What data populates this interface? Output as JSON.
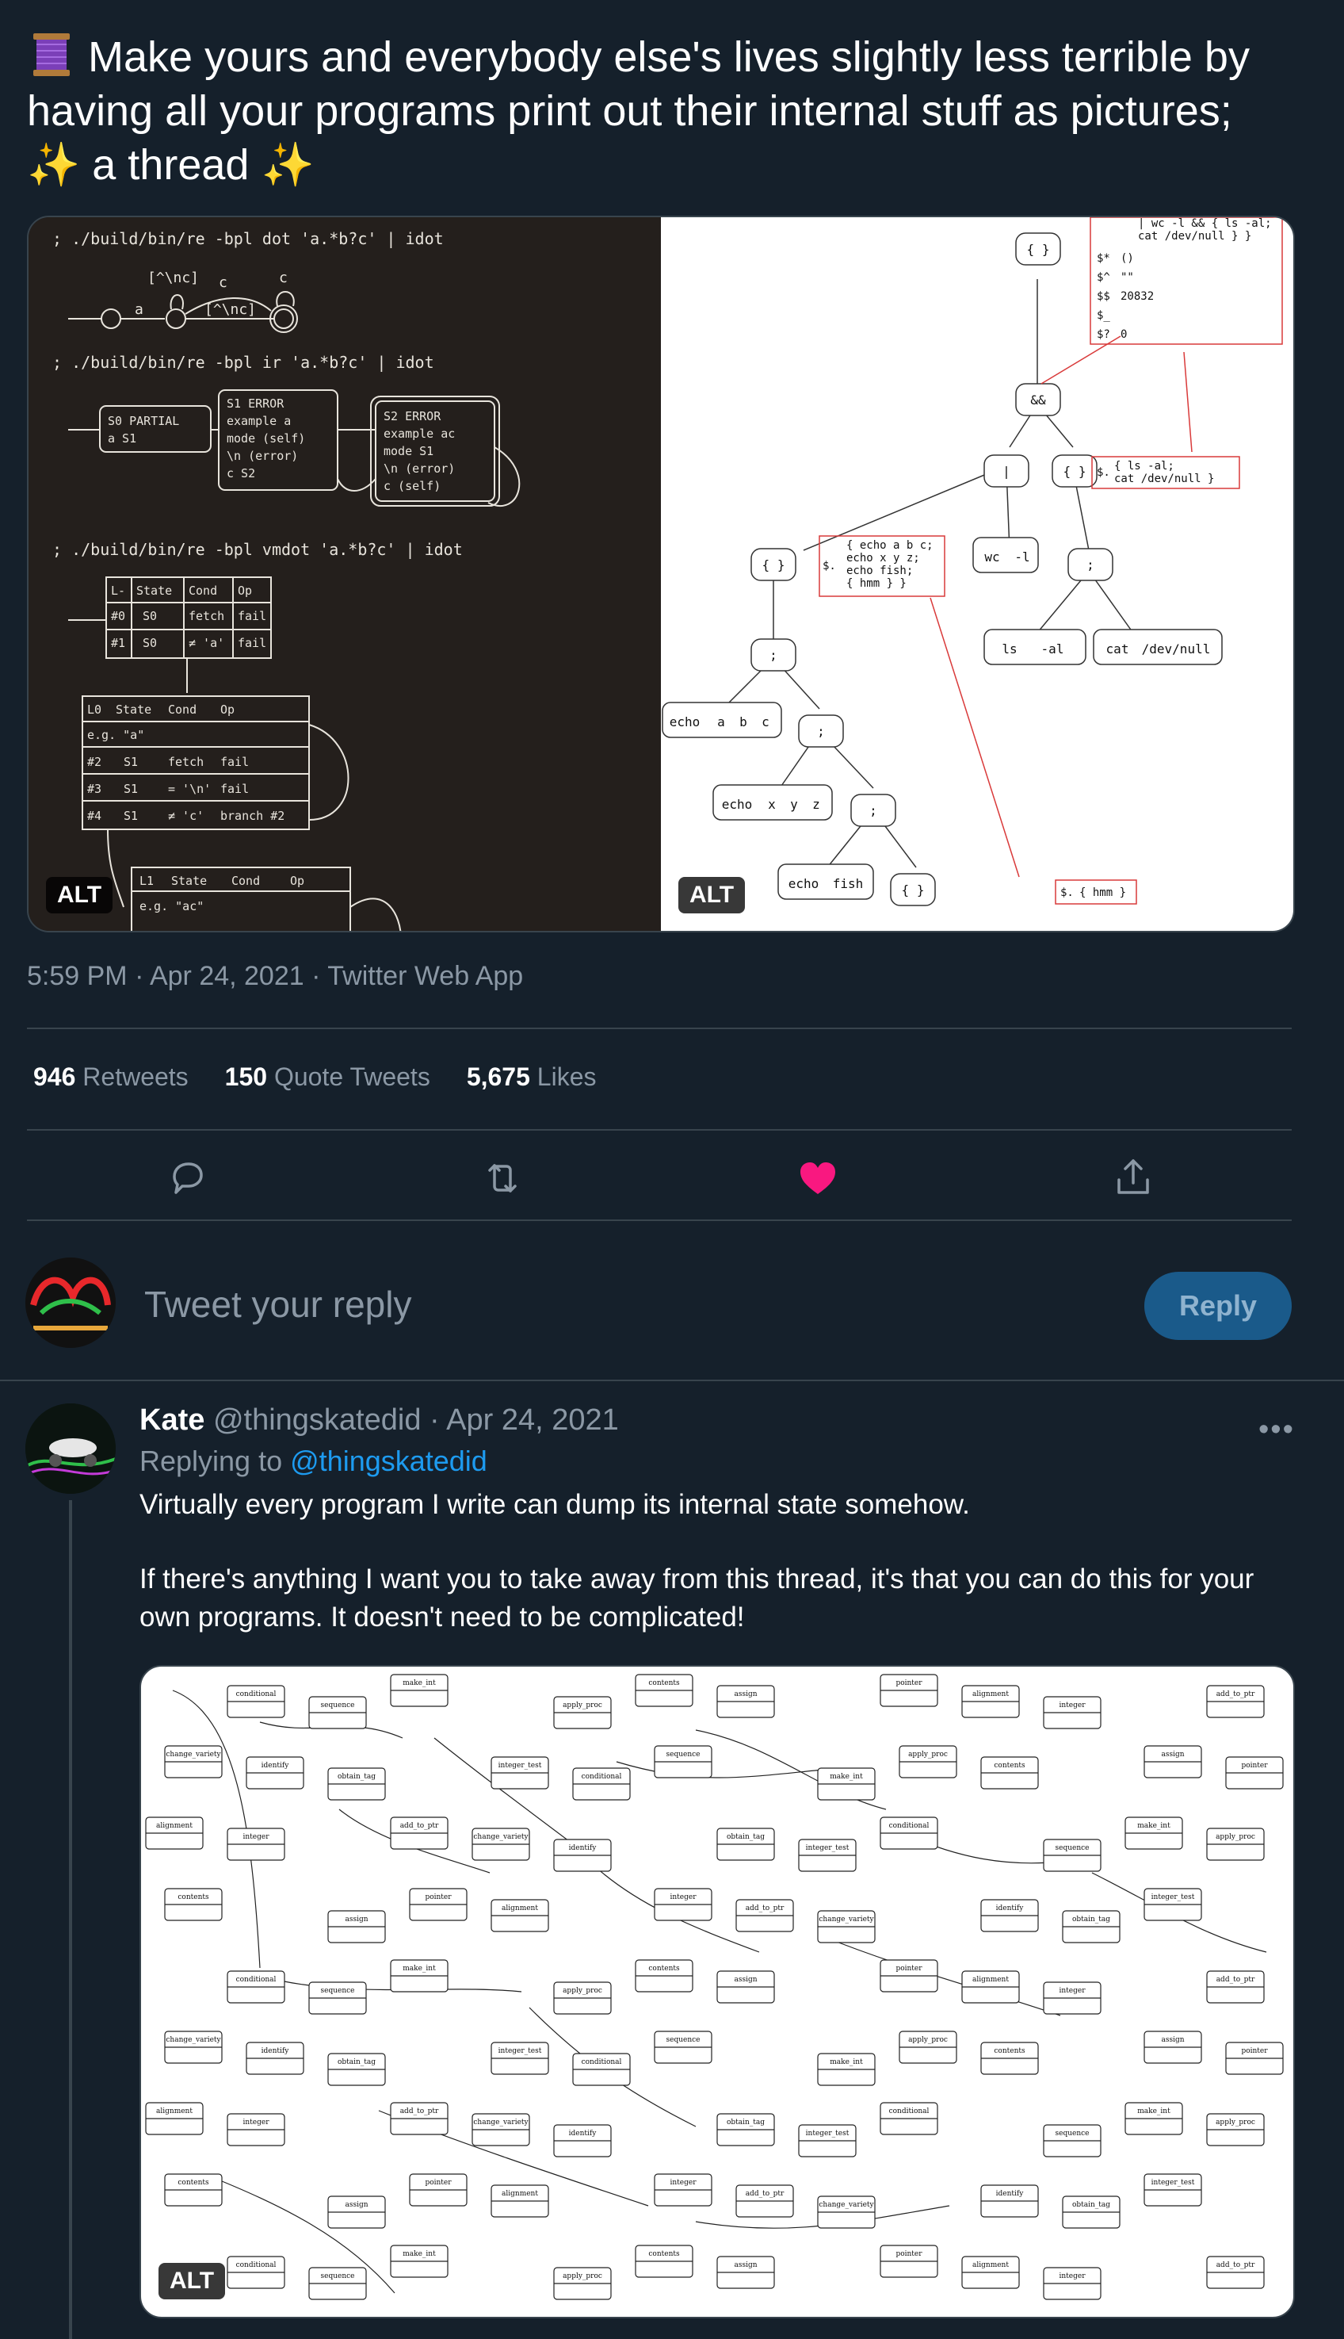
{
  "tweet": {
    "line1": "Make yours and everybody else's lives slightly less terrible by",
    "line2": "having all your programs print out their internal stuff as pictures;",
    "line3": "a thread",
    "timestamp": "5:59 PM · Apr 24, 2021 · Twitter Web App",
    "alt_label": "ALT"
  },
  "left_image": {
    "cmd1": "; ./build/bin/re -bpl dot 'a.*b?c' | idot",
    "cmd2": "; ./build/bin/re -bpl ir 'a.*b?c' | idot",
    "cmd3": "; ./build/bin/re -bpl vmdot 'a.*b?c' | idot",
    "dfa_labels": [
      "[^\\nc]",
      "c",
      "c",
      "a",
      "[^\\nc]"
    ],
    "ir_s0": [
      "S0 PARTIAL",
      "a    S1"
    ],
    "ir_s1": [
      "S1        ERROR",
      "example a",
      "mode    (self)",
      "\\n          (error)",
      "c          S2"
    ],
    "ir_s2": [
      "S2        ERROR",
      "example ac",
      "mode    S1",
      "\\n          (error)",
      "c          (self)"
    ],
    "vm_table1": {
      "headers": [
        "L-",
        "State",
        "Cond",
        "Op"
      ],
      "rows": [
        [
          "#0",
          "S0",
          "fetch",
          "fail"
        ],
        [
          "#1",
          "S0",
          "≠ 'a'",
          "fail"
        ]
      ]
    },
    "vm_table2": {
      "headers": [
        "L0",
        "State",
        "Cond",
        "Op"
      ],
      "example": "e.g. \"a\"",
      "rows": [
        [
          "#2",
          "S1",
          "fetch",
          "fail"
        ],
        [
          "#3",
          "S1",
          "= '\\n'",
          "fail"
        ],
        [
          "#4",
          "S1",
          "≠ 'c'",
          "branch #2"
        ]
      ]
    },
    "vm_table3": {
      "headers": [
        "L1",
        "State",
        "Cond",
        "Op"
      ],
      "example": "e.g. \"ac\""
    }
  },
  "right_image": {
    "nodes": [
      "{ }",
      "&&",
      "|",
      "{ }",
      "{ }",
      "!",
      ";",
      ";",
      "!",
      "!",
      ";",
      "!",
      ";",
      "!",
      "{ }"
    ],
    "leaf_labels": [
      "wc",
      "-l",
      "ls",
      "-al",
      "cat",
      "/dev/null",
      "echo",
      "a",
      "b",
      "c",
      "echo",
      "x",
      "y",
      "z",
      "echo",
      "fish"
    ],
    "vars": [
      "$*",
      "$^",
      "$$",
      "$_",
      "$?"
    ],
    "var_values": [
      "()",
      "\"\"",
      "20832",
      "",
      "0"
    ],
    "top_text": [
      "| wc -l && { ls -al;",
      "cat /dev/null } }"
    ],
    "ls_text": [
      "{ ls -al;",
      "cat /dev/null }"
    ],
    "echo_text": [
      "{ echo a b c;",
      "echo x y z;",
      "echo fish;",
      "{ hmm } }"
    ],
    "hmm_text": "{ hmm }",
    "dollar": "$."
  },
  "stats": {
    "retweets_count": "946",
    "retweets_label": "Retweets",
    "quotes_count": "150",
    "quotes_label": "Quote Tweets",
    "likes_count": "5,675",
    "likes_label": "Likes"
  },
  "actions": {
    "reply_icon": "comment-icon",
    "retweet_icon": "retweet-icon",
    "like_icon": "heart-icon",
    "share_icon": "share-icon",
    "like_color": "#f91880"
  },
  "compose": {
    "placeholder": "Tweet your reply",
    "button_label": "Reply"
  },
  "reply": {
    "name": "Kate",
    "handle": "@thingskatedid",
    "date": "· Apr 24, 2021",
    "more": "•••",
    "replying_prefix": "Replying to",
    "replying_handle": "@thingskatedid",
    "paragraph1": "Virtually every program I write can dump its internal state somehow.",
    "paragraph2": "If there's anything I want you to take away from this thread, it's that you can do this for your own programs. It doesn't need to be complicated!",
    "alt_label": "ALT",
    "graph_labels": [
      "conditional",
      "sequence",
      "make_int",
      "apply_proc",
      "contents",
      "assign",
      "pointer",
      "alignment",
      "integer",
      "add_to_ptr",
      "change_variety",
      "identify",
      "obtain_tag",
      "integer_test"
    ]
  },
  "colors": {
    "background": "#15202b",
    "divider": "#38444d",
    "muted": "#8b98a5",
    "accent": "#1d9bf0",
    "reply_button": "#1a5a8a"
  }
}
